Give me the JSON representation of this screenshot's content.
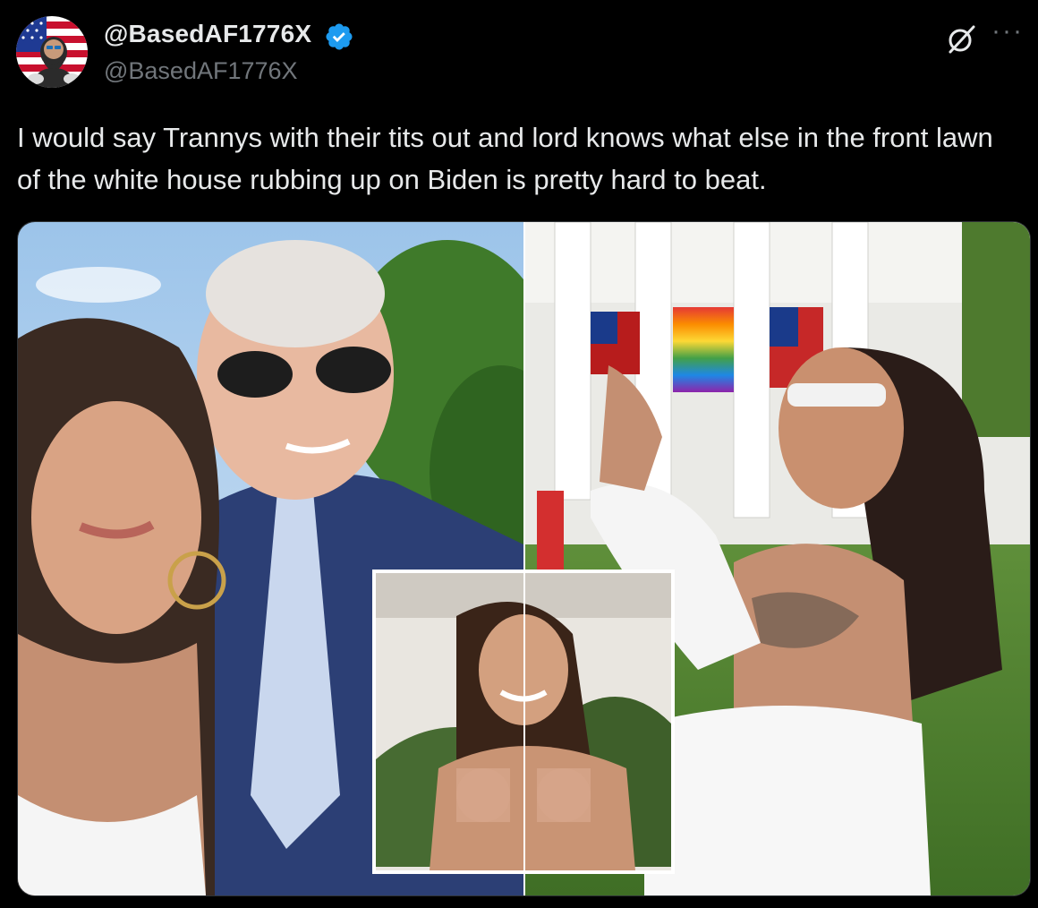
{
  "post": {
    "display_name": "@BasedAF1776X",
    "handle": "@BasedAF1776X",
    "verified": true,
    "text": "I would say Trannys with their tits out and lord knows what else in the front lawn of the white house rubbing up on Biden is pretty hard to beat.",
    "more_label": "···"
  },
  "icons": {
    "avatar": "avatar-us-flag-icon",
    "verified": "verified-badge-icon",
    "grok": "grok-icon",
    "more": "more-options-icon"
  },
  "colors": {
    "background": "#000000",
    "text_primary": "#e7e9ea",
    "text_secondary": "#71767b",
    "verified_blue": "#1d9bf0"
  }
}
